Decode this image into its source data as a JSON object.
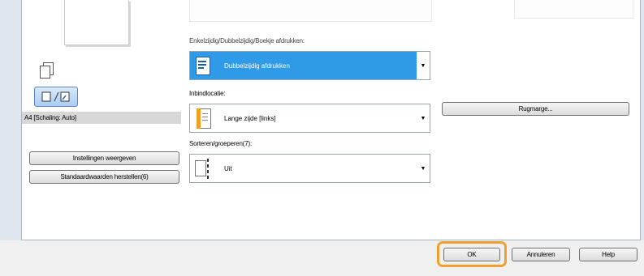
{
  "preview": {
    "scale_label": "A4 [Schaling: Auto]"
  },
  "left_buttons": {
    "show_settings": "Instellingen weergeven",
    "restore_defaults": "Standaardwaarden herstellen(6)"
  },
  "print_mode": {
    "label": "Enkelzijdig/Dubbelzijdig/Boekje afdrukken:",
    "value": "Dubbelzijdig afdrukken"
  },
  "binding": {
    "label": "Inbindlocatie:",
    "value": "Lange zijde [links]"
  },
  "sort": {
    "label": "Sorteren/groeperen(7):",
    "value": "Uit"
  },
  "gutter_button": "Rugmarge...",
  "footer": {
    "ok": "OK",
    "cancel": "Annuleren",
    "help": "Help"
  },
  "colors": {
    "selected_bg": "#2e9ae8",
    "focus_ring": "#f0a030"
  }
}
